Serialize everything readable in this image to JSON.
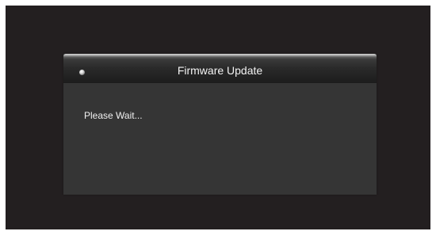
{
  "dialog": {
    "title": "Firmware Update",
    "message": "Please Wait...",
    "status_icon": "status-dot-icon"
  },
  "colors": {
    "screen_background": "#231f20",
    "dialog_background": "#353535",
    "header_dark": "#1c1c1c",
    "text": "#f2f2f2"
  }
}
